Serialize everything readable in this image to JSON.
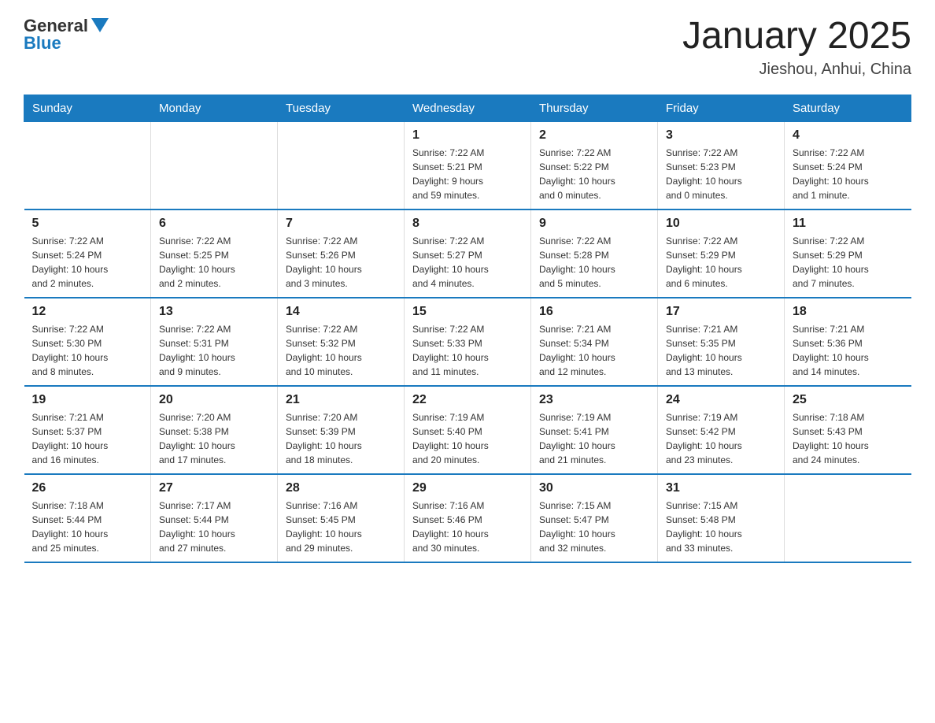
{
  "logo": {
    "general": "General",
    "blue": "Blue"
  },
  "header": {
    "title": "January 2025",
    "subtitle": "Jieshou, Anhui, China"
  },
  "weekdays": [
    "Sunday",
    "Monday",
    "Tuesday",
    "Wednesday",
    "Thursday",
    "Friday",
    "Saturday"
  ],
  "weeks": [
    [
      {
        "day": "",
        "info": ""
      },
      {
        "day": "",
        "info": ""
      },
      {
        "day": "",
        "info": ""
      },
      {
        "day": "1",
        "info": "Sunrise: 7:22 AM\nSunset: 5:21 PM\nDaylight: 9 hours\nand 59 minutes."
      },
      {
        "day": "2",
        "info": "Sunrise: 7:22 AM\nSunset: 5:22 PM\nDaylight: 10 hours\nand 0 minutes."
      },
      {
        "day": "3",
        "info": "Sunrise: 7:22 AM\nSunset: 5:23 PM\nDaylight: 10 hours\nand 0 minutes."
      },
      {
        "day": "4",
        "info": "Sunrise: 7:22 AM\nSunset: 5:24 PM\nDaylight: 10 hours\nand 1 minute."
      }
    ],
    [
      {
        "day": "5",
        "info": "Sunrise: 7:22 AM\nSunset: 5:24 PM\nDaylight: 10 hours\nand 2 minutes."
      },
      {
        "day": "6",
        "info": "Sunrise: 7:22 AM\nSunset: 5:25 PM\nDaylight: 10 hours\nand 2 minutes."
      },
      {
        "day": "7",
        "info": "Sunrise: 7:22 AM\nSunset: 5:26 PM\nDaylight: 10 hours\nand 3 minutes."
      },
      {
        "day": "8",
        "info": "Sunrise: 7:22 AM\nSunset: 5:27 PM\nDaylight: 10 hours\nand 4 minutes."
      },
      {
        "day": "9",
        "info": "Sunrise: 7:22 AM\nSunset: 5:28 PM\nDaylight: 10 hours\nand 5 minutes."
      },
      {
        "day": "10",
        "info": "Sunrise: 7:22 AM\nSunset: 5:29 PM\nDaylight: 10 hours\nand 6 minutes."
      },
      {
        "day": "11",
        "info": "Sunrise: 7:22 AM\nSunset: 5:29 PM\nDaylight: 10 hours\nand 7 minutes."
      }
    ],
    [
      {
        "day": "12",
        "info": "Sunrise: 7:22 AM\nSunset: 5:30 PM\nDaylight: 10 hours\nand 8 minutes."
      },
      {
        "day": "13",
        "info": "Sunrise: 7:22 AM\nSunset: 5:31 PM\nDaylight: 10 hours\nand 9 minutes."
      },
      {
        "day": "14",
        "info": "Sunrise: 7:22 AM\nSunset: 5:32 PM\nDaylight: 10 hours\nand 10 minutes."
      },
      {
        "day": "15",
        "info": "Sunrise: 7:22 AM\nSunset: 5:33 PM\nDaylight: 10 hours\nand 11 minutes."
      },
      {
        "day": "16",
        "info": "Sunrise: 7:21 AM\nSunset: 5:34 PM\nDaylight: 10 hours\nand 12 minutes."
      },
      {
        "day": "17",
        "info": "Sunrise: 7:21 AM\nSunset: 5:35 PM\nDaylight: 10 hours\nand 13 minutes."
      },
      {
        "day": "18",
        "info": "Sunrise: 7:21 AM\nSunset: 5:36 PM\nDaylight: 10 hours\nand 14 minutes."
      }
    ],
    [
      {
        "day": "19",
        "info": "Sunrise: 7:21 AM\nSunset: 5:37 PM\nDaylight: 10 hours\nand 16 minutes."
      },
      {
        "day": "20",
        "info": "Sunrise: 7:20 AM\nSunset: 5:38 PM\nDaylight: 10 hours\nand 17 minutes."
      },
      {
        "day": "21",
        "info": "Sunrise: 7:20 AM\nSunset: 5:39 PM\nDaylight: 10 hours\nand 18 minutes."
      },
      {
        "day": "22",
        "info": "Sunrise: 7:19 AM\nSunset: 5:40 PM\nDaylight: 10 hours\nand 20 minutes."
      },
      {
        "day": "23",
        "info": "Sunrise: 7:19 AM\nSunset: 5:41 PM\nDaylight: 10 hours\nand 21 minutes."
      },
      {
        "day": "24",
        "info": "Sunrise: 7:19 AM\nSunset: 5:42 PM\nDaylight: 10 hours\nand 23 minutes."
      },
      {
        "day": "25",
        "info": "Sunrise: 7:18 AM\nSunset: 5:43 PM\nDaylight: 10 hours\nand 24 minutes."
      }
    ],
    [
      {
        "day": "26",
        "info": "Sunrise: 7:18 AM\nSunset: 5:44 PM\nDaylight: 10 hours\nand 25 minutes."
      },
      {
        "day": "27",
        "info": "Sunrise: 7:17 AM\nSunset: 5:44 PM\nDaylight: 10 hours\nand 27 minutes."
      },
      {
        "day": "28",
        "info": "Sunrise: 7:16 AM\nSunset: 5:45 PM\nDaylight: 10 hours\nand 29 minutes."
      },
      {
        "day": "29",
        "info": "Sunrise: 7:16 AM\nSunset: 5:46 PM\nDaylight: 10 hours\nand 30 minutes."
      },
      {
        "day": "30",
        "info": "Sunrise: 7:15 AM\nSunset: 5:47 PM\nDaylight: 10 hours\nand 32 minutes."
      },
      {
        "day": "31",
        "info": "Sunrise: 7:15 AM\nSunset: 5:48 PM\nDaylight: 10 hours\nand 33 minutes."
      },
      {
        "day": "",
        "info": ""
      }
    ]
  ]
}
